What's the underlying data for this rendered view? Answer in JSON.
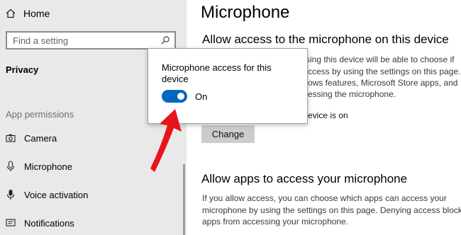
{
  "sidebar": {
    "home_label": "Home",
    "search_placeholder": "Find a setting",
    "section": "Privacy",
    "group_heading": "App permissions",
    "items": [
      {
        "label": "Camera",
        "icon": "camera-icon"
      },
      {
        "label": "Microphone",
        "icon": "microphone-icon"
      },
      {
        "label": "Voice activation",
        "icon": "voice-activation-icon"
      },
      {
        "label": "Notifications",
        "icon": "notifications-icon"
      }
    ]
  },
  "main": {
    "title": "Microphone",
    "access_heading": "Allow access to the microphone on this device",
    "access_body_lines": [
      "sing this device will be able to choose if",
      "ccess by using the settings on this page.",
      "ows features, Microsoft Store apps, and",
      "essing the microphone."
    ],
    "access_status": "evice is on",
    "change_button": "Change",
    "apps_heading": "Allow apps to access your microphone",
    "apps_body_lines": [
      "If you allow access, you can choose which apps can access your",
      "microphone by using the settings on this page. Denying access blocks",
      "apps from accessing your microphone."
    ]
  },
  "popup": {
    "title": "Microphone access for this device",
    "toggle_state": "On",
    "toggle_color": "#0067c0"
  },
  "annotation": {
    "arrow_color": "#e8141b"
  }
}
